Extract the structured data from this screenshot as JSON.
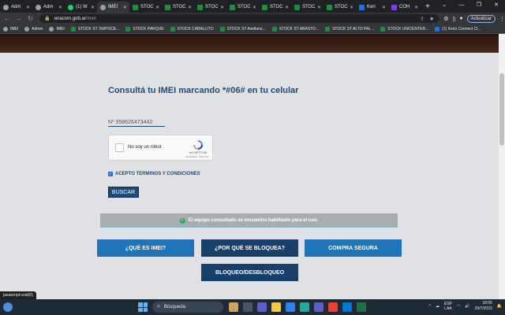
{
  "browser": {
    "tabs": [
      {
        "label": "Adm",
        "icon": "globe-icon",
        "kind": "g"
      },
      {
        "label": "Adm",
        "icon": "globe-icon",
        "kind": "g"
      },
      {
        "label": "(1) W",
        "icon": "whatsapp-icon",
        "kind": "wa"
      },
      {
        "label": "IMEI",
        "icon": "enacom-icon",
        "kind": "g",
        "active": true
      },
      {
        "label": "STOC",
        "icon": "sheets-icon",
        "kind": "sheet"
      },
      {
        "label": "STOC",
        "icon": "sheets-icon",
        "kind": "sheet"
      },
      {
        "label": "STOC",
        "icon": "sheets-icon",
        "kind": "sheet"
      },
      {
        "label": "STOC",
        "icon": "sheets-icon",
        "kind": "sheet"
      },
      {
        "label": "STOC",
        "icon": "sheets-icon",
        "kind": "sheet"
      },
      {
        "label": "STOC",
        "icon": "sheets-icon",
        "kind": "sheet"
      },
      {
        "label": "STOC",
        "icon": "sheets-icon",
        "kind": "sheet"
      },
      {
        "label": "Keri",
        "icon": "kerio-icon",
        "kind": "kerio"
      },
      {
        "label": "COH",
        "icon": "coh-icon",
        "kind": "coh"
      }
    ],
    "url_domain": "enacom.gob.ar",
    "url_path": "/imei",
    "update_label": "Actualizar",
    "bookmarks": [
      {
        "label": "IMEI",
        "kind": "g"
      },
      {
        "label": "Admin",
        "kind": "g"
      },
      {
        "label": "IMEI",
        "kind": "g"
      },
      {
        "label": "STOCK ST SWPOCE...",
        "kind": "sheet"
      },
      {
        "label": "STOCK PARQUE",
        "kind": "sheet"
      },
      {
        "label": "STOCK CABALLITO",
        "kind": "sheet"
      },
      {
        "label": "STOCK ST Avellane...",
        "kind": "sheet"
      },
      {
        "label": "STOCK ST ABASTO...",
        "kind": "sheet"
      },
      {
        "label": "STOCK ST ALTO PAL...",
        "kind": "sheet"
      },
      {
        "label": "STOCK UNICENTER...",
        "kind": "sheet"
      },
      {
        "label": "(1) Kerio Connect Cl...",
        "kind": "kerio"
      }
    ],
    "status_url": "javascript:void(0)"
  },
  "page": {
    "heading": "Consultá tu IMEI marcando *#06# en tu celular",
    "imei_value": "Nº 358626473442",
    "captcha": {
      "label": "No soy un robot",
      "brand": "reCAPTCHA",
      "terms": "Privacidad - Términos"
    },
    "terms_label": "ACEPTO TERMINOS Y CONDICIONES",
    "search_button": "BUSCAR",
    "result_message": "El equipo consultado se encuentra habilitado para el uso.",
    "buttons": {
      "what_is_imei": "¿QUÉ ES IMEI?",
      "why_blocked": "¿POR QUÉ SE BLOQUEA?",
      "safe_purchase": "COMPRA SEGURA",
      "block_unblock": "BLOQUEO/DESBLOQUEO"
    }
  },
  "taskbar": {
    "search_label": "Búsqueda",
    "lang_top": "ESP",
    "lang_bottom": "LAA",
    "time": "18:55",
    "date": "29/7/2023"
  },
  "colors": {
    "brand_blue": "#1f4b7a",
    "button_light": "#1f73b7",
    "button_dark": "#173f6a",
    "success": "#34a853"
  }
}
